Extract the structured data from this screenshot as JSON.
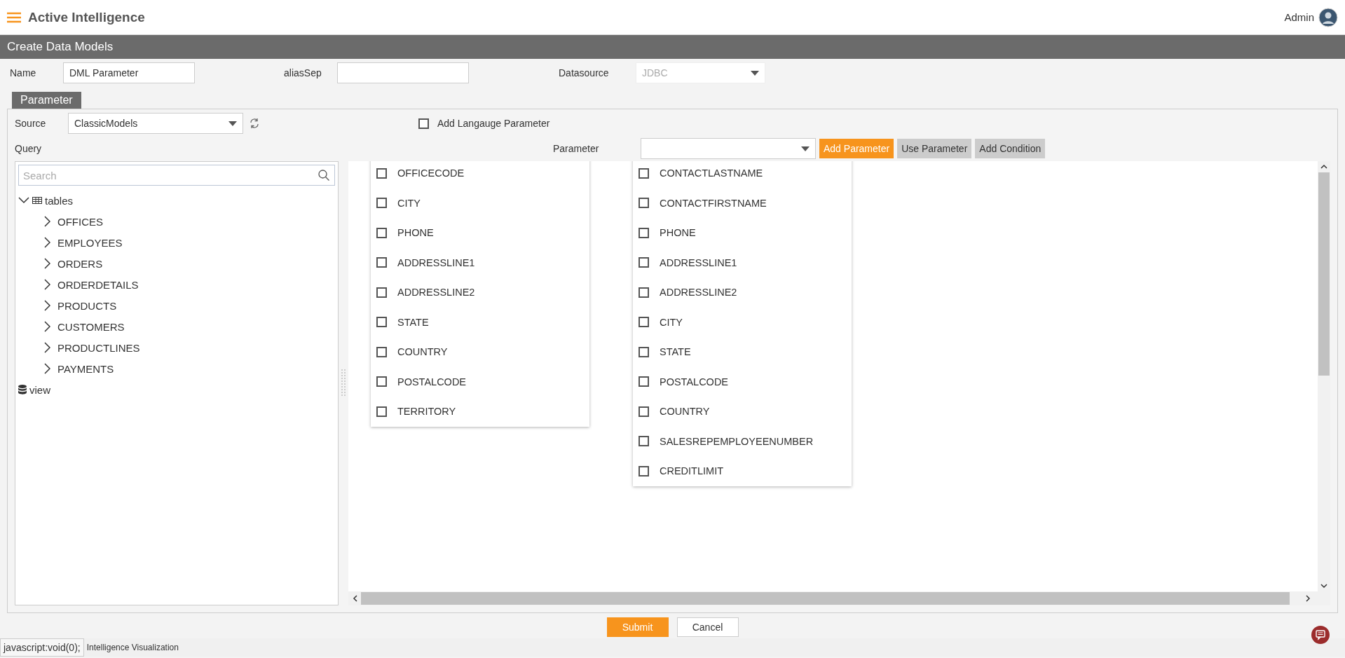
{
  "header": {
    "app_title": "Active Intelligence",
    "user": "Admin"
  },
  "page_title": "Create Data Models",
  "form": {
    "name": {
      "label": "Name",
      "value": "DML Parameter"
    },
    "alias_sep": {
      "label": "aliasSep"
    },
    "datasource": {
      "label": "Datasource",
      "value": "JDBC",
      "disabled": true
    }
  },
  "tabs": [
    {
      "label": "Parameter",
      "selected": true
    }
  ],
  "source": {
    "label": "Source",
    "value": "ClassicModels"
  },
  "language_parameter": {
    "label": "Add Langauge Parameter",
    "checked": false
  },
  "query_label": "Query",
  "parameter": {
    "label": "Parameter"
  },
  "buttons": [
    {
      "label": "Add Parameter",
      "kind": "primary"
    },
    {
      "label": "Use Parameter",
      "kind": "secondary"
    },
    {
      "label": "Add Condition",
      "kind": "secondary"
    }
  ],
  "tree": {
    "search_placeholder": "Search",
    "nodes": [
      {
        "label": "tables",
        "kind": "tables",
        "expanded": true,
        "children": [
          {
            "label": "OFFICES",
            "kind": "table",
            "expanded": false
          },
          {
            "label": "EMPLOYEES",
            "kind": "table",
            "expanded": false
          },
          {
            "label": "ORDERS",
            "kind": "table",
            "expanded": false
          },
          {
            "label": "ORDERDETAILS",
            "kind": "table",
            "expanded": false
          },
          {
            "label": "PRODUCTS",
            "kind": "table",
            "expanded": false
          },
          {
            "label": "CUSTOMERS",
            "kind": "table",
            "expanded": false
          },
          {
            "label": "PRODUCTLINES",
            "kind": "table",
            "expanded": false
          },
          {
            "label": "PAYMENTS",
            "kind": "table",
            "expanded": false
          }
        ]
      },
      {
        "label": "view",
        "kind": "view"
      }
    ]
  },
  "table_cards": [
    {
      "columns": [
        {
          "name": "OFFICECODE",
          "checked": false
        },
        {
          "name": "CITY",
          "checked": false
        },
        {
          "name": "PHONE",
          "checked": false
        },
        {
          "name": "ADDRESSLINE1",
          "checked": false
        },
        {
          "name": "ADDRESSLINE2",
          "checked": false
        },
        {
          "name": "STATE",
          "checked": false
        },
        {
          "name": "COUNTRY",
          "checked": false
        },
        {
          "name": "POSTALCODE",
          "checked": false
        },
        {
          "name": "TERRITORY",
          "checked": false
        }
      ]
    },
    {
      "columns": [
        {
          "name": "CONTACTLASTNAME",
          "checked": false
        },
        {
          "name": "CONTACTFIRSTNAME",
          "checked": false
        },
        {
          "name": "PHONE",
          "checked": false
        },
        {
          "name": "ADDRESSLINE1",
          "checked": false
        },
        {
          "name": "ADDRESSLINE2",
          "checked": false
        },
        {
          "name": "CITY",
          "checked": false
        },
        {
          "name": "STATE",
          "checked": false
        },
        {
          "name": "POSTALCODE",
          "checked": false
        },
        {
          "name": "COUNTRY",
          "checked": false
        },
        {
          "name": "SALESREPEMPLOYEENUMBER",
          "checked": false
        },
        {
          "name": "CREDITLIMIT",
          "checked": false
        }
      ]
    }
  ],
  "footer_buttons": [
    {
      "label": "Submit",
      "kind": "primary"
    },
    {
      "label": "Cancel",
      "kind": "default"
    }
  ],
  "status_bar": {
    "link_preview": "javascript:void(0);",
    "text": "Intelligence Visualization"
  }
}
